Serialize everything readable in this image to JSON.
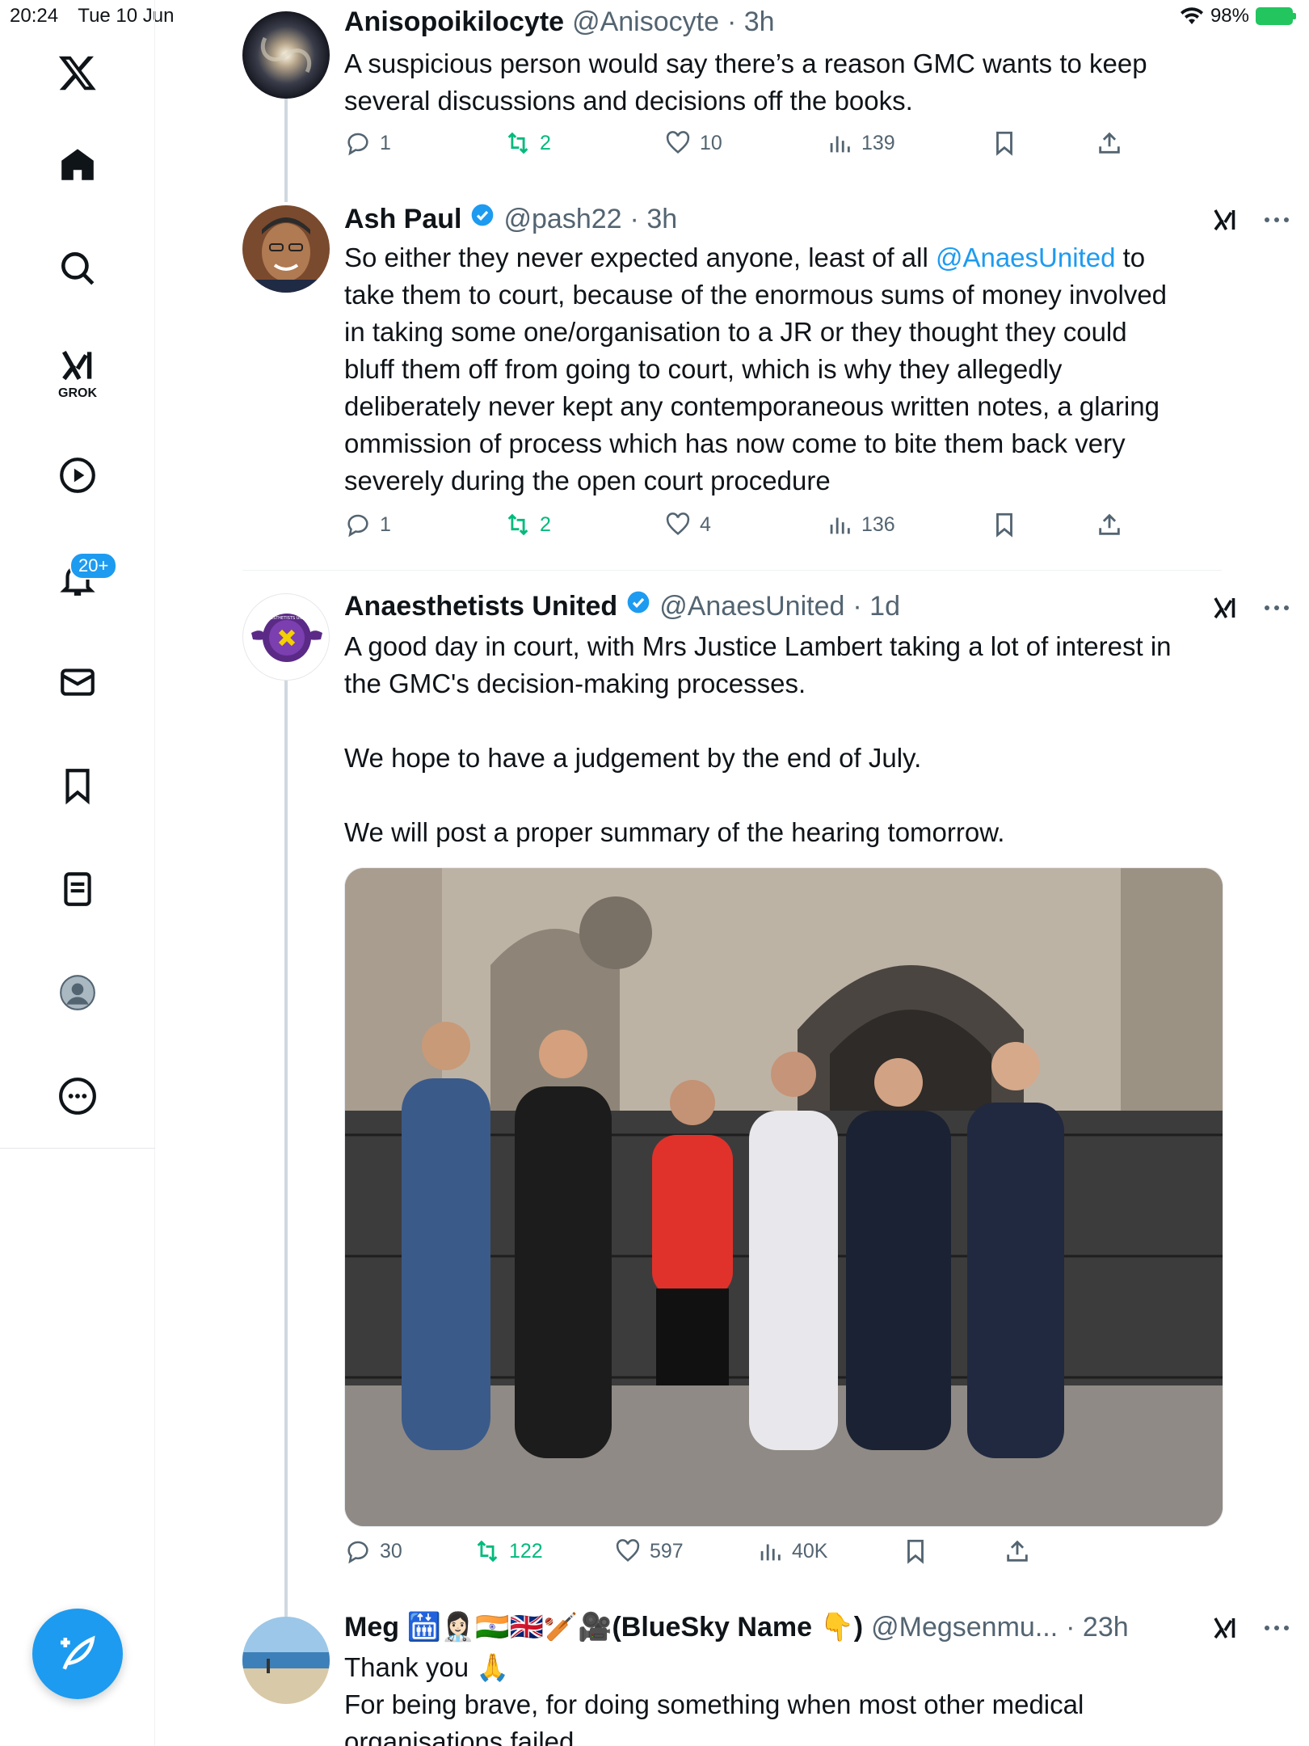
{
  "status_bar": {
    "time": "20:24",
    "date": "Tue 10 Jun",
    "battery": "98%"
  },
  "sidebar": {
    "grok_label": "GROK",
    "notifications_badge": "20+"
  },
  "tweets": [
    {
      "name": "Anisopoikilocyte",
      "handle": "@Anisocyte",
      "time": "· 3h",
      "text": "A suspicious person would say there’s a reason GMC wants to keep\nseveral discussions and decisions off the books.",
      "replies": "1",
      "reposts": "2",
      "likes": "10",
      "views": "139"
    },
    {
      "name": "Ash Paul",
      "handle": "@pash22",
      "time": "· 3h",
      "text_before": "So either they never expected anyone, least of all ",
      "mention": "@AnaesUnited",
      "text_after": " to\ntake them to court, because of the enormous sums of money involved\nin taking some one/organisation to a JR or they thought they could\nbluff them off from going to court, which is why they allegedly\ndeliberately never kept any contemporaneous written notes, a glaring\nommission of process which has now come to bite them back very\nseverely during the open court procedure",
      "replies": "1",
      "reposts": "2",
      "likes": "4",
      "views": "136"
    },
    {
      "name": "Anaesthetists United",
      "handle": "@AnaesUnited",
      "time": "· 1d",
      "avatar_text": "ANAESTHETISTS UNITED",
      "text": "A good day in court, with Mrs Justice Lambert taking a lot of interest in\nthe GMC's decision-making processes.\n\nWe hope to have a judgement by the end of July.\n\nWe will post a proper summary of the hearing tomorrow.",
      "replies": "30",
      "reposts": "122",
      "likes": "597",
      "views": "40K"
    },
    {
      "name": "Meg 🛗👩🏻‍⚕️🇮🇳🇬🇧🏏🎥(BlueSky Name 👇)",
      "handle": "@Megsenmu...",
      "time": "· 23h",
      "text": "Thank you 🙏\nFor being brave, for doing something when most other medical\norganisations failed"
    }
  ],
  "colors": {
    "accent": "#1d9bf0",
    "repost": "#00ba7c",
    "muted": "#536471"
  }
}
